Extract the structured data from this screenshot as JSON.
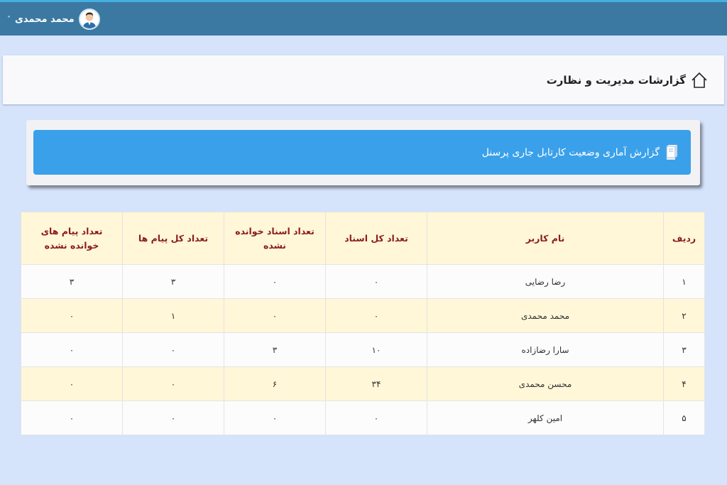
{
  "topbar": {
    "user_name": "محمد محمدی",
    "chevron": "˅",
    "avatar_icon": "user-avatar-icon"
  },
  "page": {
    "title": "گزارشات مدیریت و نظارت",
    "home_icon": "home-icon"
  },
  "banner": {
    "title": "گزارش آماری وضعیت کارتابل جاری پرسنل",
    "icon": "book-icon"
  },
  "table": {
    "headers": {
      "row": "ردیف",
      "user_name": "نام کاربر",
      "total_docs": "تعداد کل اسناد",
      "unread_docs": "تعداد اسناد خوانده نشده",
      "total_msgs": "تعداد کل پیام ها",
      "unread_msgs": "تعداد پیام های خوانده نشده"
    },
    "rows": [
      {
        "row": "۱",
        "user_name": "رضا رضایی",
        "total_docs": "۰",
        "unread_docs": "۰",
        "total_msgs": "۳",
        "unread_msgs": "۳"
      },
      {
        "row": "۲",
        "user_name": "محمد محمدی",
        "total_docs": "۰",
        "unread_docs": "۰",
        "total_msgs": "۱",
        "unread_msgs": "۰"
      },
      {
        "row": "۳",
        "user_name": "سارا رضازاده",
        "total_docs": "۱۰",
        "unread_docs": "۳",
        "total_msgs": "۰",
        "unread_msgs": "۰"
      },
      {
        "row": "۴",
        "user_name": "محسن محمدی",
        "total_docs": "۳۴",
        "unread_docs": "۶",
        "total_msgs": "۰",
        "unread_msgs": "۰"
      },
      {
        "row": "۵",
        "user_name": "امین کلهر",
        "total_docs": "۰",
        "unread_docs": "۰",
        "total_msgs": "۰",
        "unread_msgs": "۰"
      }
    ]
  },
  "colors": {
    "topbar": "#3b79a2",
    "banner": "#3aa0ea",
    "header_cell": "#fff7d8",
    "header_text": "#8b1c1c",
    "background": "#d5e3fb"
  }
}
